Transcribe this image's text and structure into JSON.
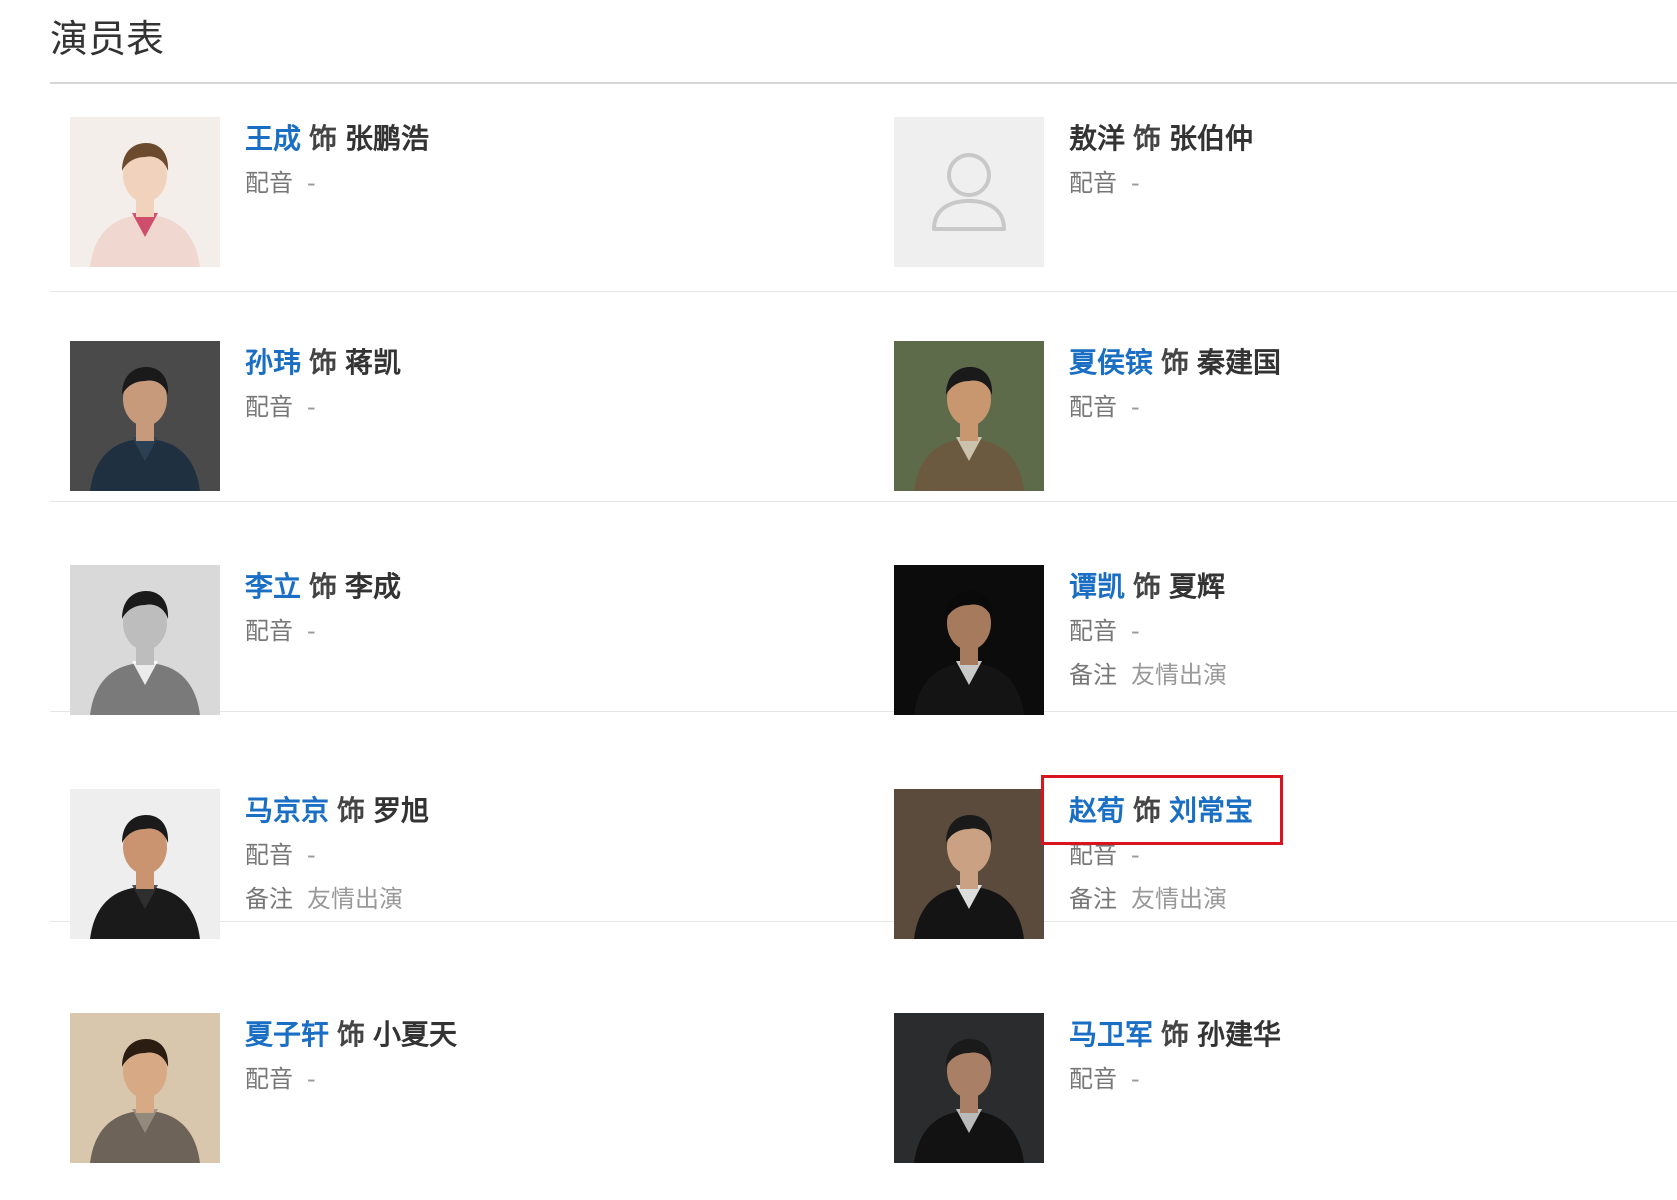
{
  "page": {
    "title": "演员表"
  },
  "labels": {
    "as_word": "饰",
    "dub_label": "配音",
    "note_label": "备注"
  },
  "colors": {
    "link": "#1a6fc4",
    "highlight": "#d9141e"
  },
  "cast": [
    {
      "actor": "王成",
      "role": "张鹏浩",
      "dub": "-",
      "note": null,
      "photo": "portrait-photo",
      "actor_is_link": true,
      "role_is_link": false
    },
    {
      "actor": "敖洋",
      "role": "张伯仲",
      "dub": "-",
      "note": null,
      "photo": "default-avatar-icon",
      "actor_is_link": false,
      "role_is_link": false
    },
    {
      "actor": "孙玮",
      "role": "蒋凯",
      "dub": "-",
      "note": null,
      "photo": "portrait-photo",
      "actor_is_link": true,
      "role_is_link": false
    },
    {
      "actor": "夏侯镔",
      "role": "秦建国",
      "dub": "-",
      "note": null,
      "photo": "portrait-photo",
      "actor_is_link": true,
      "role_is_link": false
    },
    {
      "actor": "李立",
      "role": "李成",
      "dub": "-",
      "note": null,
      "photo": "portrait-photo",
      "actor_is_link": true,
      "role_is_link": false
    },
    {
      "actor": "谭凯",
      "role": "夏辉",
      "dub": "-",
      "note": "友情出演",
      "photo": "portrait-photo",
      "actor_is_link": true,
      "role_is_link": false
    },
    {
      "actor": "马京京",
      "role": "罗旭",
      "dub": "-",
      "note": "友情出演",
      "photo": "portrait-photo",
      "actor_is_link": true,
      "role_is_link": false
    },
    {
      "actor": "赵荀",
      "role": "刘常宝",
      "dub": "-",
      "note": "友情出演",
      "photo": "portrait-photo",
      "actor_is_link": true,
      "role_is_link": true,
      "highlighted": true
    },
    {
      "actor": "夏子轩",
      "role": "小夏天",
      "dub": "-",
      "note": null,
      "photo": "portrait-photo",
      "actor_is_link": true,
      "role_is_link": false
    },
    {
      "actor": "马卫军",
      "role": "孙建华",
      "dub": "-",
      "note": null,
      "photo": "portrait-photo",
      "actor_is_link": true,
      "role_is_link": false
    }
  ]
}
